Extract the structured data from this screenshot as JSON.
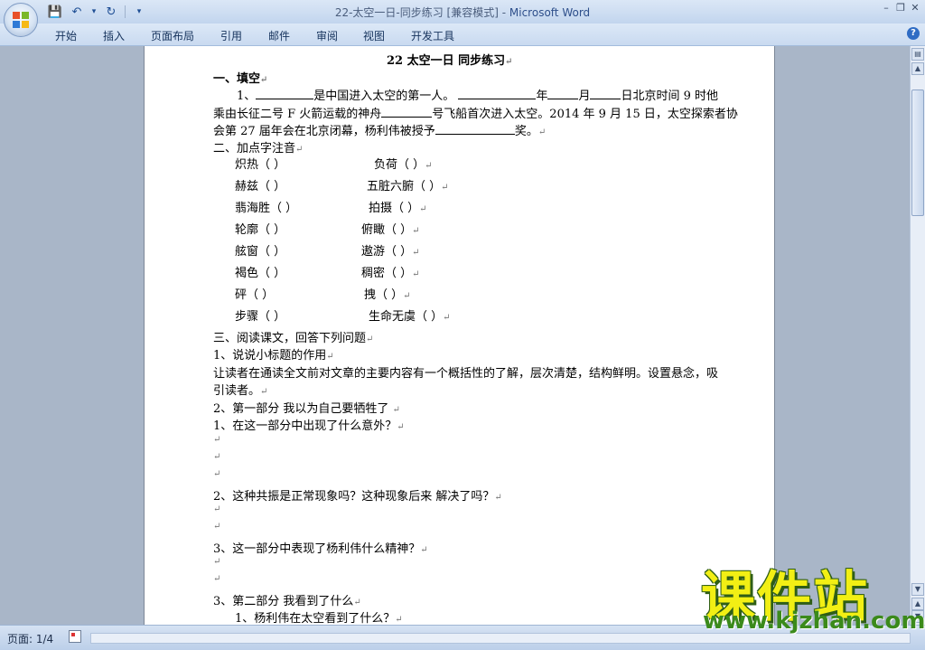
{
  "window": {
    "title": "22-太空一日-同步练习 [兼容模式] - ",
    "app_name": "Microsoft Word",
    "minimize": "–",
    "restore": "❐",
    "close": "✕"
  },
  "qat": {
    "save": "💾",
    "undo": "↶",
    "redo": "↻",
    "more": "▾"
  },
  "ribbon": {
    "tabs": [
      "开始",
      "插入",
      "页面布局",
      "引用",
      "邮件",
      "审阅",
      "视图",
      "开发工具"
    ],
    "help": "?"
  },
  "doc": {
    "title": "22  太空一日   同步练习",
    "section1": "一、填空",
    "q1_a": "1、",
    "q1_b": "是中国进入太空的第一人。",
    "q1_c": "年",
    "q1_d": "月",
    "q1_e": "日北京时间 9 时他",
    "q1_line2a": "乘由长征二号 F 火箭运载的神舟",
    "q1_line2b": "号飞船首次进入太空。2014 年 9 月 15 日，太空探索者协",
    "q1_line3a": "会第 27 届年会在北京闭幕，杨利伟被授予",
    "q1_line3b": "奖。",
    "section2": "二、加点字注音",
    "pinyin": [
      [
        "炽热（        ）",
        "负荷（         ）"
      ],
      [
        "赫兹（    ）",
        "五脏六腑（     ）"
      ],
      [
        "翡海胜（     ）",
        "拍摄（       ）"
      ],
      [
        "轮廓（         ）",
        "俯瞰（        ）"
      ],
      [
        "舷窗（        ）",
        "遨游（         ）"
      ],
      [
        "褐色（        ）",
        "稠密（       ）"
      ],
      [
        "砰（          ）",
        "拽（           ）"
      ],
      [
        "步骤（        ）",
        "生命无虞（     ）"
      ]
    ],
    "section3": "三、阅读课文，回答下列问题",
    "r1": "1、说说小标题的作用",
    "r1_ans1": " 让读者在通读全文前对文章的主要内容有一个概括性的了解，层次清楚，结构鲜明。设置悬念，吸",
    "r1_ans2": "引读者。",
    "r2": "2、第一部分      我以为自己要牺牲了 ",
    "r2_q1": "1、在这一部分中出现了什么意外？",
    "r2_q2": "2、这种共振是正常现象吗？这种现象后来 解决了吗？",
    "r2_q3": "3、这一部分中表现了杨利伟什么精神？",
    "r3": "3、第二部分      我看到了什么",
    "r3_q1": "1、杨利伟在太空看到了什么？",
    "para_mark": "↵"
  },
  "status": {
    "page": "页面: 1/4"
  },
  "watermark": {
    "main": "课件站",
    "url": "www.kjzhan.com"
  }
}
